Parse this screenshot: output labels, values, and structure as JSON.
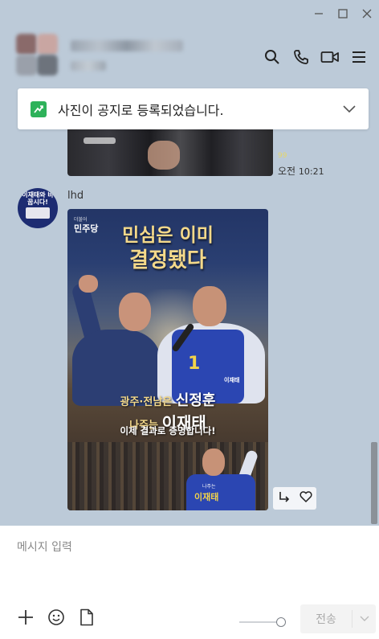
{
  "window": {
    "controls": [
      "minimize-icon",
      "maximize-icon",
      "close-icon"
    ]
  },
  "header": {
    "title": "",
    "subtitle": "",
    "icons": [
      "search-icon",
      "phone-icon",
      "video-icon",
      "menu-icon"
    ]
  },
  "notice": {
    "text": "사진이 공지로 등록되었습니다.",
    "icon": "notice-chart-icon"
  },
  "messages": [
    {
      "type": "photo",
      "read_count": "99",
      "time_period": "오전",
      "time": "10:21"
    },
    {
      "type": "photo",
      "sender": "lhd",
      "avatar_text": "이재태와 바꿉시다!",
      "poster": {
        "party_small": "더불어",
        "party": "민주당",
        "headline_line1": "민심은 이미",
        "headline_line2": "결정됐다",
        "vest_number": "1",
        "vest_name": "이재태",
        "line1_prefix": "광주·전남은 ",
        "line1_name": "신정훈",
        "line2_prefix": "나주는 ",
        "line2_name": "이재태",
        "line3": "이제 결과로 증명합니다!",
        "bottom_small": "나주는",
        "bottom_name": "이재태"
      },
      "actions": [
        "share-icon",
        "heart-icon"
      ]
    }
  ],
  "composer": {
    "placeholder": "메시지 입력",
    "send_label": "전송",
    "tools": [
      "plus-icon",
      "emoji-icon",
      "file-icon"
    ]
  },
  "colors": {
    "background": "#bccad8",
    "notice_icon": "#2eb25a",
    "poster_gold": "#f4d98a"
  }
}
